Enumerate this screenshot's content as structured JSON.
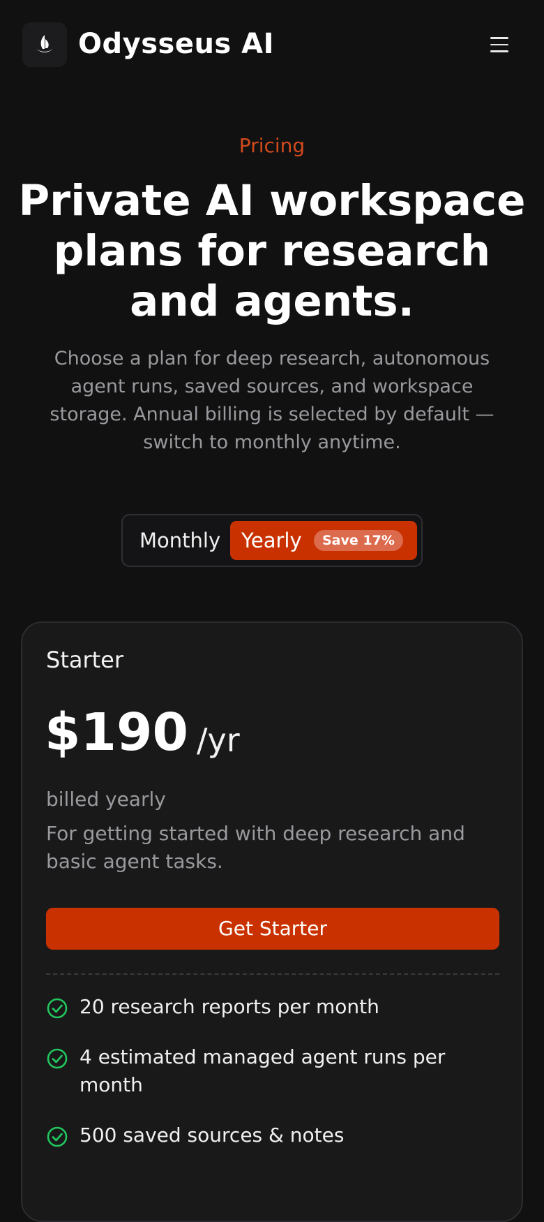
{
  "header": {
    "brand": "Odysseus AI",
    "logo_icon": "sail-logo-icon",
    "menu_icon": "hamburger-menu-icon"
  },
  "hero": {
    "eyebrow": "Pricing",
    "headline": "Private AI workspace plans for research and agents.",
    "subtext": "Choose a plan for deep research, autonomous agent runs, saved sources, and workspace storage. Annual billing is selected by default — switch to monthly anytime."
  },
  "billing_toggle": {
    "monthly_label": "Monthly",
    "yearly_label": "Yearly",
    "save_badge": "Save 17%",
    "selected": "Yearly"
  },
  "plan": {
    "name": "Starter",
    "price": "$190",
    "unit": "/yr",
    "billed": "billed yearly",
    "description": "For getting started with deep research and basic agent tasks.",
    "cta": "Get Starter",
    "features": [
      "20 research reports per month",
      "4 estimated managed agent runs per month",
      "500 saved sources & notes"
    ]
  },
  "colors": {
    "accent": "#c93200",
    "eyebrow": "#d24a1c",
    "check": "#22c55e",
    "background": "#111112",
    "card": "#19191a"
  }
}
